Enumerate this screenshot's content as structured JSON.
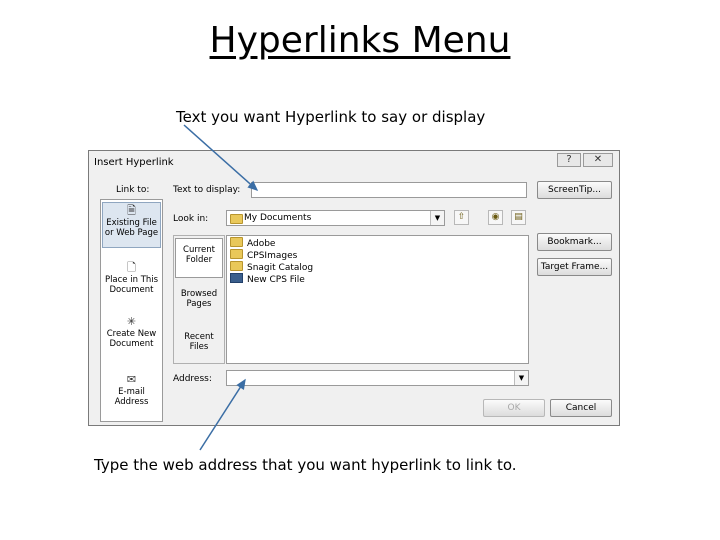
{
  "slide": {
    "title": "Hyperlinks Menu",
    "caption_top": "Text you want Hyperlink to say or display",
    "caption_bottom": "Type the web address that you want hyperlink to link to."
  },
  "dialog": {
    "title": "Insert Hyperlink",
    "help_label": "?",
    "close_label": "✕",
    "link_to_label": "Link to:",
    "link_to_items": [
      {
        "label": "Existing File or Web Page",
        "icon": "globe-file-icon"
      },
      {
        "label": "Place in This Document",
        "icon": "document-place-icon"
      },
      {
        "label": "Create New Document",
        "icon": "new-document-icon"
      },
      {
        "label": "E-mail Address",
        "icon": "email-icon"
      }
    ],
    "text_to_display_label": "Text to display:",
    "text_to_display_value": "",
    "screentip_label": "ScreenTip...",
    "look_in_label": "Look in:",
    "look_in_value": "My Documents",
    "side_tabs": [
      {
        "label": "Current Folder"
      },
      {
        "label": "Browsed Pages"
      },
      {
        "label": "Recent Files"
      }
    ],
    "files": [
      {
        "name": "Adobe",
        "type": "folder"
      },
      {
        "name": "CPSImages",
        "type": "folder"
      },
      {
        "name": "Snagit Catalog",
        "type": "folder"
      },
      {
        "name": "New CPS File",
        "type": "file"
      }
    ],
    "bookmark_label": "Bookmark...",
    "target_frame_label": "Target Frame...",
    "address_label": "Address:",
    "address_value": "",
    "ok_label": "OK",
    "cancel_label": "Cancel"
  },
  "colors": {
    "dialog_bg": "#f0f0f0",
    "folder": "#e9c85a",
    "arrow": "#3b6ea5"
  }
}
